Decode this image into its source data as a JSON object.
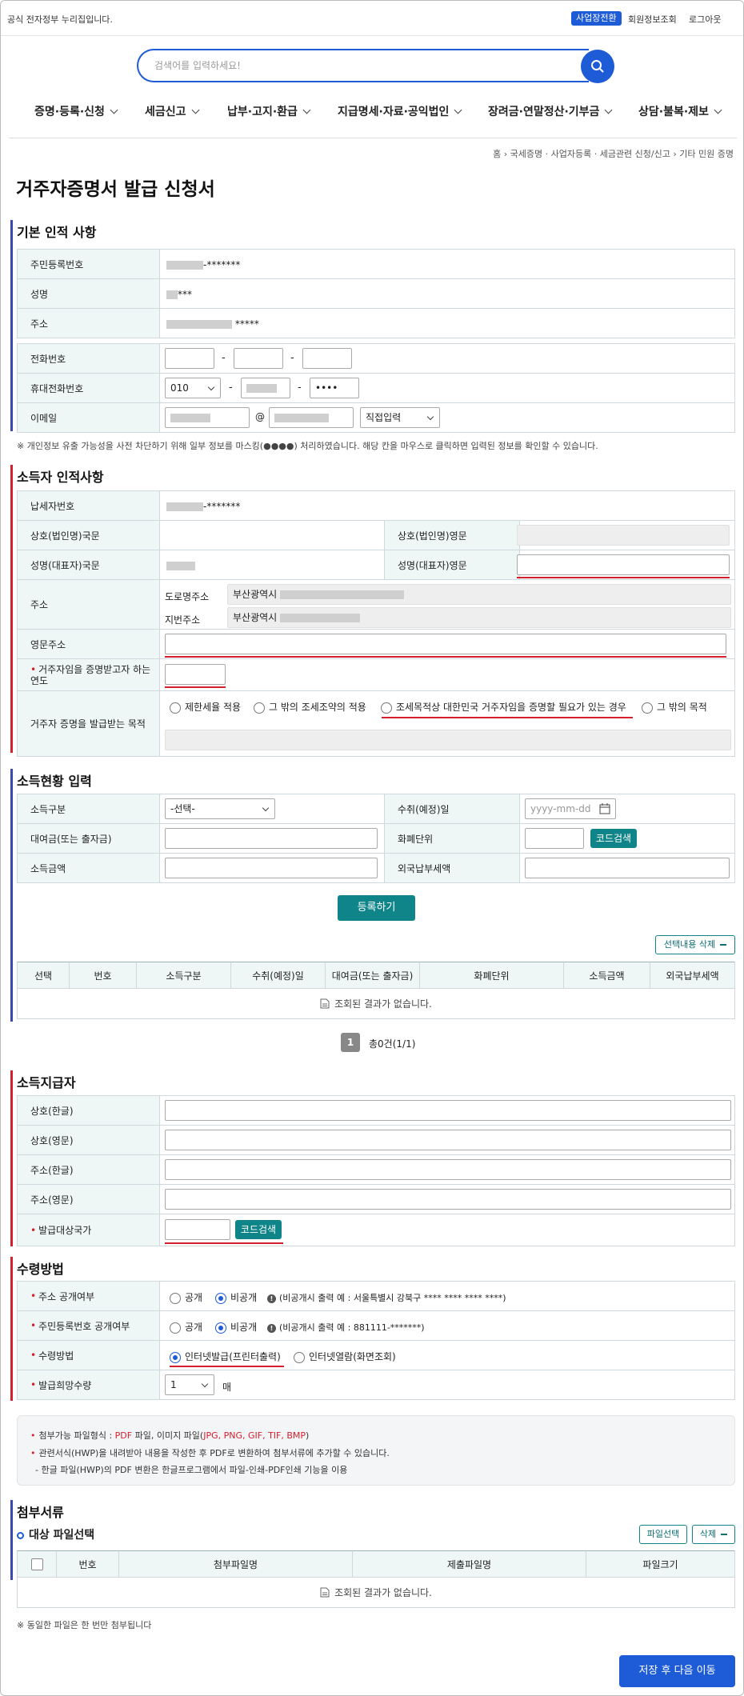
{
  "topbar": {
    "gov_text": "공식 전자정부 누리집입니다.",
    "biz_switch": "사업장전환",
    "member_info": "회원정보조회",
    "logout": "로그아웃"
  },
  "search": {
    "placeholder": "검색어를 입력하세요!"
  },
  "gnb": [
    "증명·등록·신청",
    "세금신고",
    "납부·고지·환급",
    "지급명세·자료·공익법인",
    "장려금·연말정산·기부금",
    "상담·불복·제보"
  ],
  "breadcrumb": {
    "home": "홈",
    "c1": "국세증명 · 사업자등록 · 세금관련 신청/신고",
    "c2": "기타 민원 증명"
  },
  "page_title": "거주자증명서 발급 신청서",
  "basic": {
    "title": "기본 인적 사항",
    "rrn_label": "주민등록번호",
    "rrn_value": "-*******",
    "name_label": "성명",
    "name_value": "***",
    "addr_label": "주소",
    "addr_value": "*****",
    "phone_label": "전화번호",
    "mobile_label": "휴대전화번호",
    "mobile_prefix": "010",
    "mobile_last": "••••",
    "email_label": "이메일",
    "email_at": "@",
    "email_select": "직접입력",
    "note": "※ 개인정보 유출 가능성을 사전 차단하기 위해 일부 정보를 마스킹(●●●●) 처리하였습니다. 해당 칸을 마우스로 클릭하면 입력된 정보를 확인할 수 있습니다."
  },
  "income_person": {
    "title": "소득자 인적사항",
    "tin_label": "납세자번호",
    "tin_value": "-*******",
    "corp_kr_label": "상호(법인명)국문",
    "corp_en_label": "상호(법인명)영문",
    "rep_kr_label": "성명(대표자)국문",
    "rep_en_label": "성명(대표자)영문",
    "addr_label": "주소",
    "road_label": "도로명주소",
    "road_value": "부산광역시",
    "lot_label": "지번주소",
    "lot_value": "부산광역시",
    "en_addr_label": "영문주소",
    "year_label": "거주자임을 증명받고자 하는 연도",
    "purpose_label": "거주자 증명을 발급받는 목적",
    "purpose_opts": [
      "제한세율 적용",
      "그 밖의 조세조약의 적용",
      "조세목적상 대한민국 거주자임을 증명할 필요가 있는 경우",
      "그 밖의 목적"
    ]
  },
  "income_status": {
    "title": "소득현황 입력",
    "kind_label": "소득구분",
    "kind_select": "-선택-",
    "date_label": "수취(예정)일",
    "date_placeholder": "yyyy-mm-dd",
    "amount_label": "대여금(또는 출자금)",
    "currency_label": "화폐단위",
    "code_search": "코드검색",
    "income_label": "소득금액",
    "foreign_tax_label": "외국납부세액",
    "register": "등록하기",
    "delete_selected": "선택내용 삭제",
    "columns": [
      "선택",
      "번호",
      "소득구분",
      "수취(예정)일",
      "대여금(또는 출자금)",
      "화폐단위",
      "소득금액",
      "외국납부세액"
    ],
    "empty": "조회된 결과가 없습니다.",
    "page": "1",
    "total": "총0건(1/1)"
  },
  "payer": {
    "title": "소득지급자",
    "name_kr": "상호(한글)",
    "name_en": "상호(영문)",
    "addr_kr": "주소(한글)",
    "addr_en": "주소(영문)",
    "country_label": "발급대상국가",
    "code_search": "코드검색"
  },
  "receive": {
    "title": "수령방법",
    "addr_open_label": "주소 공개여부",
    "open": "공개",
    "closed": "비공개",
    "addr_hint": "(비공개시 출력 예 : 서울특별시 강북구 **** **** **** ****)",
    "rrn_open_label": "주민등록번호 공개여부",
    "rrn_hint": "(비공개시 출력 예 : 881111-*******)",
    "method_label": "수령방법",
    "method_opt1": "인터넷발급(프린터출력)",
    "method_opt2": "인터넷열람(화면조회)",
    "count_label": "발급희망수량",
    "count_value": "1",
    "count_unit": "매"
  },
  "info": {
    "l1a": "첨부가능 파일형식 : ",
    "l1b": "PDF",
    "l1c": " 파일, 이미지 파일(",
    "l1d": "JPG, PNG, GIF, TIF, BMP",
    "l1e": ")",
    "l2": "관련서식(HWP)을 내려받아 내용을 작성한 후 PDF로 변환하여 첨부서류에 추가할 수 있습니다.",
    "l3": "- 한글 파일(HWP)의 PDF 변환은 한글프로그램에서 파일-인쇄-PDF인쇄 기능을 이용"
  },
  "attach": {
    "title": "첨부서류",
    "sub": "대상 파일선택",
    "select": "파일선택",
    "delete": "삭제",
    "columns": [
      "번호",
      "첨부파일명",
      "제출파일명",
      "파일크기"
    ],
    "empty": "조회된 결과가 없습니다.",
    "note": "※ 동일한 파일은 한 번만 첨부됩니다"
  },
  "next": "저장 후 다음 이동"
}
